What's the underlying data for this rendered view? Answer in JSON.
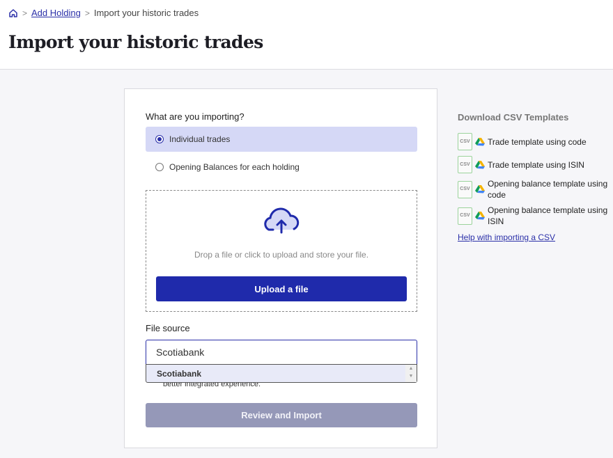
{
  "breadcrumb": {
    "home_icon": "home-icon",
    "items": [
      "Add Holding",
      "Import your historic trades"
    ]
  },
  "page": {
    "title": "Import your historic trades"
  },
  "form": {
    "question": "What are you importing?",
    "options": [
      {
        "label": "Individual trades",
        "selected": true
      },
      {
        "label": "Opening Balances for each holding",
        "selected": false
      }
    ],
    "drop_text": "Drop a file or click to upload and store your file.",
    "upload_label": "Upload a file",
    "file_source_label": "File source",
    "file_source_value": "Scotiabank",
    "dropdown_options": [
      "Scotiabank"
    ],
    "partial_hint": "better integrated experience.",
    "review_label": "Review and Import"
  },
  "sidebar": {
    "title": "Download CSV Templates",
    "templates": [
      "Trade template using code",
      "Trade template using ISIN",
      "Opening balance template using code",
      "Opening balance template using ISIN"
    ],
    "csv_icon_text": "CSV",
    "help_link": "Help with importing a CSV"
  },
  "colors": {
    "accent": "#1f2aab",
    "selected_bg": "#d5d8f6",
    "disabled": "#9598b8"
  }
}
